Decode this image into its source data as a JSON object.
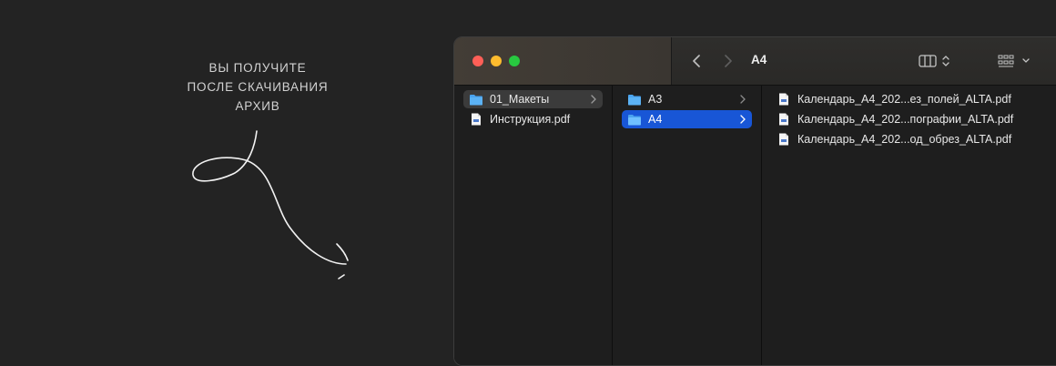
{
  "caption": {
    "line1": "ВЫ ПОЛУЧИТЕ",
    "line2": "ПОСЛЕ СКАЧИВАНИЯ",
    "line3": "АРХИВ"
  },
  "window": {
    "title": "A4",
    "icons": {
      "back": "chevron-left-icon",
      "forward": "chevron-right-icon",
      "view_columns": "column-view-icon",
      "view_options": "grid-view-icon"
    },
    "traffic_lights": {
      "close": "#fe5f57",
      "minimize": "#febc2e",
      "maximize": "#28c840"
    }
  },
  "columns": [
    {
      "items": [
        {
          "label": "01_Макеты",
          "type": "folder",
          "selected": "inactive"
        },
        {
          "label": "Инструкция.pdf",
          "type": "pdf"
        }
      ]
    },
    {
      "items": [
        {
          "label": "A3",
          "type": "folder"
        },
        {
          "label": "A4",
          "type": "folder",
          "selected": "active"
        }
      ]
    },
    {
      "items": [
        {
          "label": "Календарь_A4_202...ез_полей_ALTA.pdf",
          "type": "pdf"
        },
        {
          "label": "Календарь_A4_202...пографии_ALTA.pdf",
          "type": "pdf"
        },
        {
          "label": "Календарь_A4_202...од_обрез_ALTA.pdf",
          "type": "pdf"
        }
      ]
    }
  ],
  "colors": {
    "selection_active": "#1856d6",
    "selection_inactive": "#3b3b3b",
    "folder": "#4aa3ee"
  }
}
